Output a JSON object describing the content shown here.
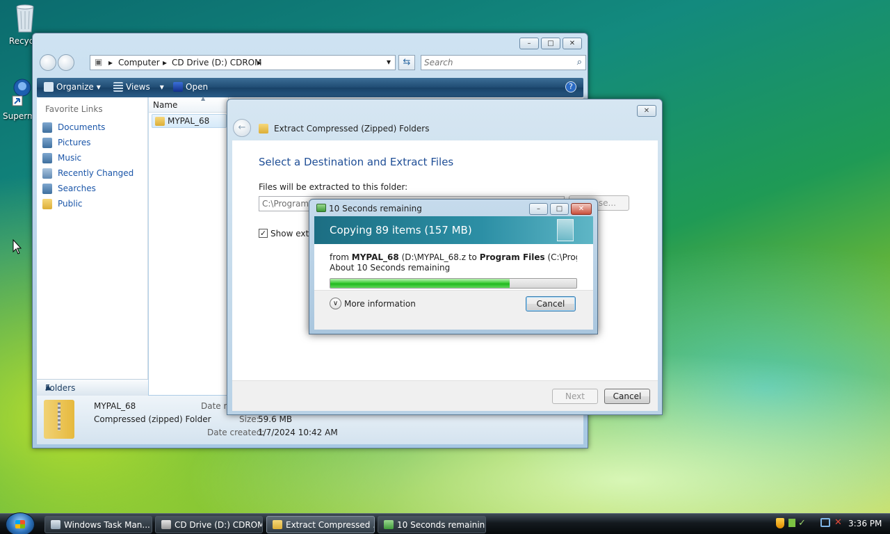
{
  "desktop": {
    "icons": [
      {
        "label": "Recycle",
        "icon": "recycle-bin-icon"
      },
      {
        "label": "Superm",
        "icon": "app-shortcut-icon"
      }
    ]
  },
  "explorer": {
    "breadcrumb": [
      "Computer",
      "CD Drive (D:) CDROM"
    ],
    "search_placeholder": "Search",
    "toolbar": {
      "organize": "Organize",
      "views": "Views",
      "open": "Open"
    },
    "favorites_title": "Favorite Links",
    "favorites": [
      "Documents",
      "Pictures",
      "Music",
      "Recently Changed",
      "Searches",
      "Public"
    ],
    "folders_label": "Folders",
    "column_name": "Name",
    "files": [
      "MYPAL_68"
    ],
    "details": {
      "name": "MYPAL_68",
      "type": "Compressed (zipped) Folder",
      "date_modified_label": "Date m",
      "size_label": "Size:",
      "size_value": "59.6 MB",
      "date_created_label": "Date created:",
      "date_created_value": "1/7/2024 10:42 AM"
    }
  },
  "wizard": {
    "title": "Extract Compressed (Zipped) Folders",
    "heading": "Select a Destination and Extract Files",
    "dest_label": "Files will be extracted to this folder:",
    "dest_value": "C:\\Program",
    "browse_label": "se...",
    "show_label": "Show extra",
    "show_checked": true,
    "next_label": "Next",
    "cancel_label": "Cancel"
  },
  "progress": {
    "title": "10 Seconds remaining",
    "banner": "Copying 89 items (157 MB)",
    "from_word": "from",
    "source_name": "MYPAL_68",
    "source_path": "(D:\\MYPAL_68.z",
    "to_word": "to",
    "dest_name": "Program Files",
    "dest_path": "(C:\\Program File",
    "remaining": "About 10 Seconds remaining",
    "percent_complete": 73,
    "more_info": "More information",
    "cancel": "Cancel"
  },
  "taskbar": {
    "tasks": [
      {
        "label": "Windows Task Man...",
        "active": false
      },
      {
        "label": "CD Drive (D:) CDROM",
        "active": false
      },
      {
        "label": "Extract Compressed ...",
        "active": true
      },
      {
        "label": "10 Seconds remaining",
        "active": false
      }
    ],
    "clock": "3:36 PM"
  },
  "colors": {
    "link": "#1a55a8",
    "heading": "#1f4e96",
    "progress_green": "#22b81e"
  }
}
